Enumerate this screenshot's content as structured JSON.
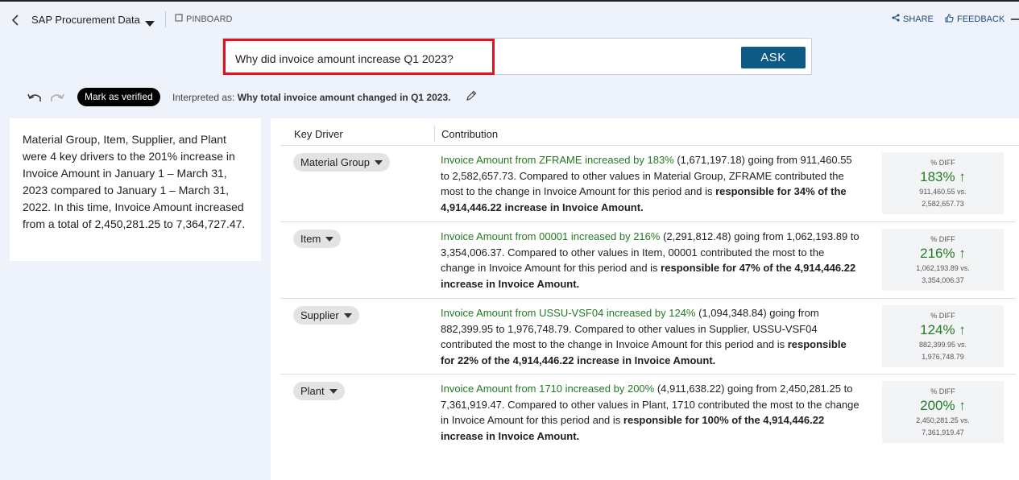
{
  "header": {
    "dataset_name": "SAP Procurement Data",
    "pinboard_label": "PINBOARD",
    "share_label": "SHARE",
    "feedback_label": "FEEDBACK"
  },
  "search": {
    "query": "Why did invoice amount increase Q1 2023?",
    "ask_label": "ASK"
  },
  "toolbar": {
    "verify_label": "Mark as verified",
    "interpreted_prefix": "Interpreted as:",
    "interpreted_value": "Why total invoice amount changed in Q1 2023."
  },
  "summary": {
    "text": "Material Group, Item, Supplier, and Plant were 4 key drivers to the 201% increase in Invoice Amount in January 1 – March 31, 2023 compared to January 1 – March 31, 2022. In this time, Invoice Amount increased from a total of 2,450,281.25 to 7,364,727.47."
  },
  "table": {
    "col_driver": "Key Driver",
    "col_contribution": "Contribution",
    "diff_label": "% DIFF",
    "rows": [
      {
        "driver": "Material Group",
        "lead": "Invoice Amount from ZFRAME increased by 183%",
        "body": " (1,671,197.18) going from 911,460.55 to 2,582,657.73. Compared to other values in Material Group, ZFRAME contributed the most to the change in Invoice Amount for this period and is ",
        "bold": "responsible for 34% of the 4,914,446.22 increase in Invoice Amount.",
        "pct": "183% ↑",
        "from": "911,460.55 vs.",
        "to": "2,582,657.73"
      },
      {
        "driver": "Item",
        "lead": "Invoice Amount from 00001 increased by 216%",
        "body": " (2,291,812.48) going from 1,062,193.89 to 3,354,006.37. Compared to other values in Item, 00001 contributed the most to the change in Invoice Amount for this period and is ",
        "bold": "responsible for 47% of the 4,914,446.22 increase in Invoice Amount.",
        "pct": "216% ↑",
        "from": "1,062,193.89 vs.",
        "to": "3,354,006.37"
      },
      {
        "driver": "Supplier",
        "lead": "Invoice Amount from USSU-VSF04 increased by 124%",
        "body": " (1,094,348.84) going from 882,399.95 to 1,976,748.79. Compared to other values in Supplier, USSU-VSF04 contributed the most to the change in Invoice Amount for this period and is ",
        "bold": "responsible for 22% of the 4,914,446.22 increase in Invoice Amount.",
        "pct": "124% ↑",
        "from": "882,399.95 vs.",
        "to": "1,976,748.79"
      },
      {
        "driver": "Plant",
        "lead": "Invoice Amount from 1710 increased by 200%",
        "body": " (4,911,638.22) going from 2,450,281.25 to 7,361,919.47. Compared to other values in Plant, 1710 contributed the most to the change in Invoice Amount for this period and is ",
        "bold": "responsible for 100% of the 4,914,446.22 increase in Invoice Amount.",
        "pct": "200% ↑",
        "from": "2,450,281.25 vs.",
        "to": "7,361,919.47"
      }
    ]
  },
  "colors": {
    "accent": "#0f5a85",
    "positive": "#237a23",
    "highlight_border": "#e0141e"
  }
}
